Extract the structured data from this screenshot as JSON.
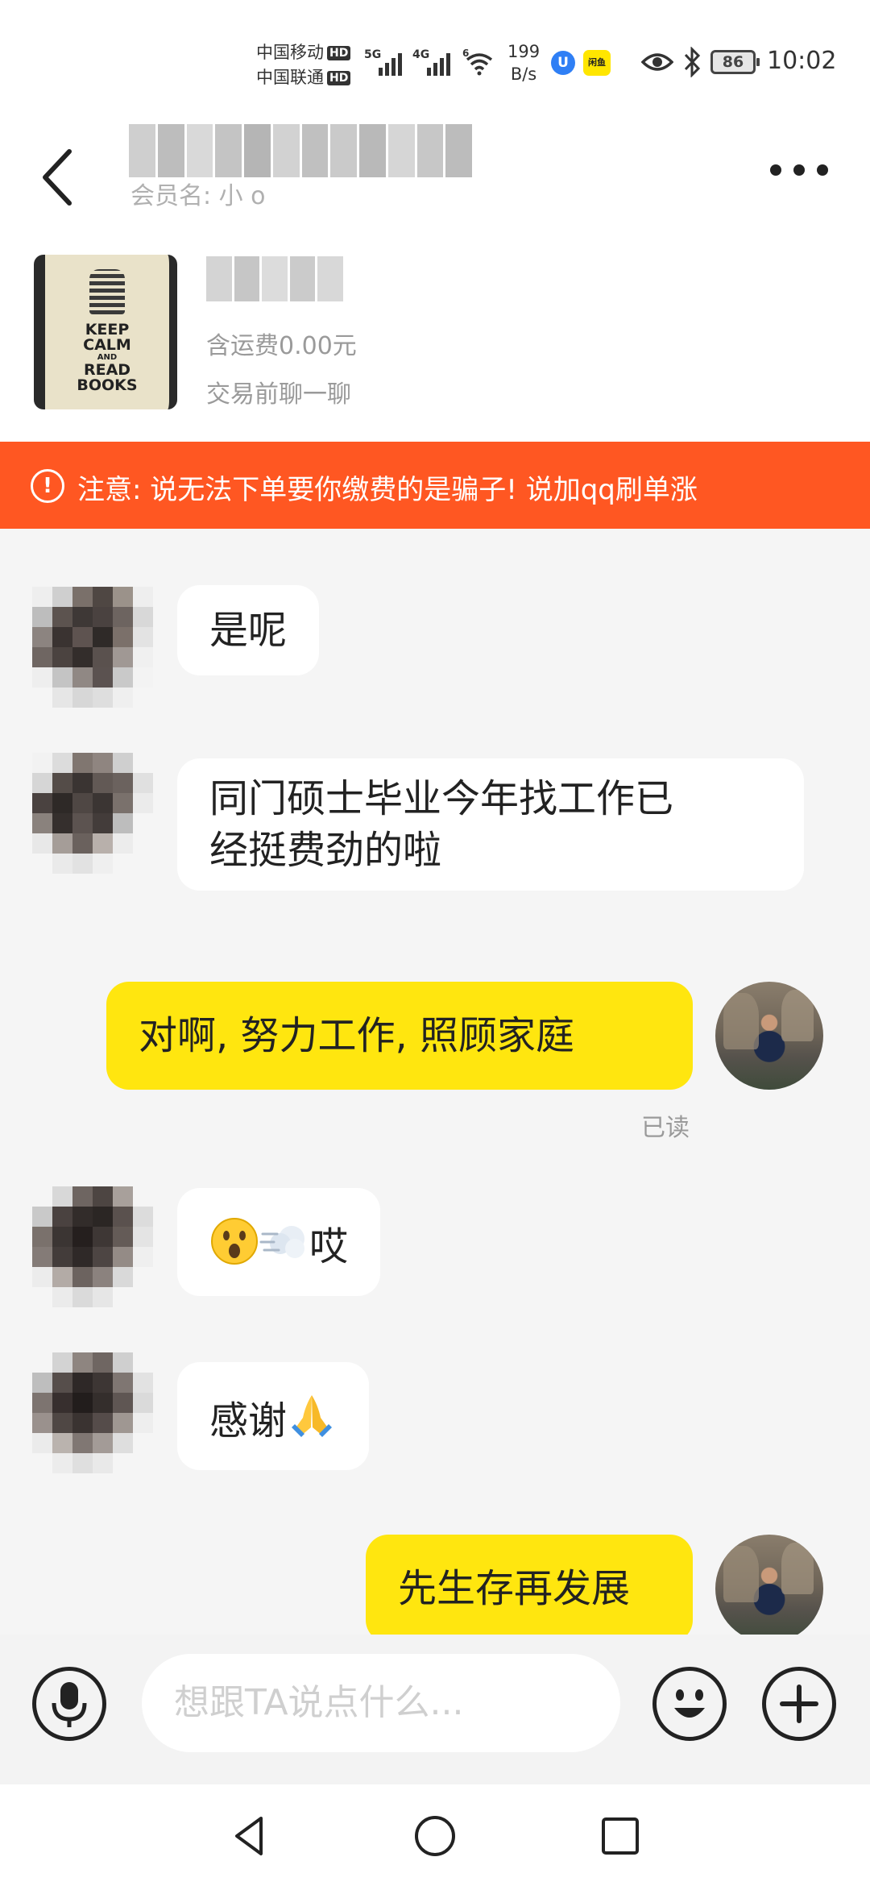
{
  "status_bar": {
    "carrier1": "中国移动",
    "carrier2": "中国联通",
    "hd": "HD",
    "net1": "5G",
    "net2": "4G",
    "net3": "6",
    "speed_value": "199",
    "speed_unit": "B/s",
    "app_badge_1": "U",
    "app_badge_2": "闲鱼",
    "battery": "86",
    "time": "10:02"
  },
  "header": {
    "member_label": "会员名: 小    o"
  },
  "product": {
    "shipping": "含运费0.00元",
    "chat_before": "交易前聊一聊"
  },
  "warning": {
    "icon": "!",
    "text": "注意: 说无法下单要你缴费的是骗子! 说加qq刷单涨"
  },
  "messages": [
    {
      "direction": "in",
      "text": "是呢"
    },
    {
      "direction": "in",
      "text_line1": "同门硕士毕业今年找工作已",
      "text_line2": "经挺费劲的啦"
    },
    {
      "direction": "out",
      "text": "对啊, 努力工作, 照顾家庭",
      "status": "已读"
    },
    {
      "direction": "in",
      "text": "哎",
      "emoji": [
        "astonished-face-emoji",
        "dash-emoji"
      ]
    },
    {
      "direction": "in",
      "text": "感谢",
      "emoji": [
        "folded-hands-emoji"
      ]
    },
    {
      "direction": "out",
      "text": "先生存再发展"
    }
  ],
  "input": {
    "placeholder": "想跟TA说点什么..."
  },
  "icons": {
    "back": "back-arrow-icon",
    "more": "more-dots-icon",
    "voice": "microphone-icon",
    "emoji": "smiley-icon",
    "plus": "plus-icon",
    "nav_back": "nav-back-triangle-icon",
    "nav_home": "nav-home-circle-icon",
    "nav_recent": "nav-recent-square-icon"
  },
  "colors": {
    "accent_yellow": "#ffe60f",
    "warning_orange": "#ff5722",
    "background": "#f5f5f5"
  }
}
